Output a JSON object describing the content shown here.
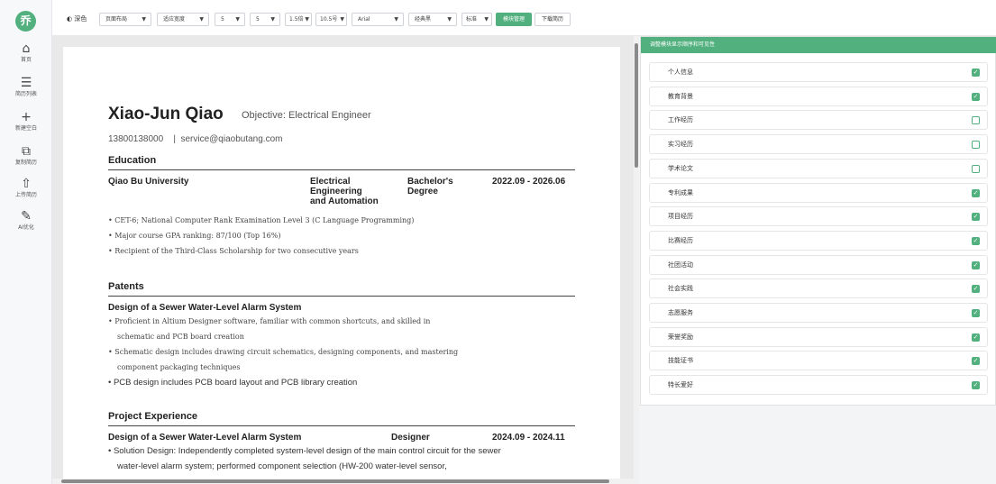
{
  "rail": {
    "logo": "乔",
    "items": [
      {
        "icon": "⌂",
        "label": "首页"
      },
      {
        "icon": "☰",
        "label": "简历列表"
      },
      {
        "icon": "+",
        "label": "新建空白"
      },
      {
        "icon": "⧉",
        "label": "复制简历"
      },
      {
        "icon": "⇧",
        "label": "上传简历"
      },
      {
        "icon": "✎",
        "label": "AI优化"
      }
    ]
  },
  "toolbar": {
    "theme_icon": "◐",
    "theme_label": "深色",
    "layout": "页面布局",
    "width": "适应宽度",
    "opt1": "5",
    "opt2": "5",
    "line_height": "1.5倍",
    "font_size": "10.5号",
    "font_family": "Arial",
    "template": "经典黑",
    "standard": "标准",
    "module_manage": "模块管理",
    "download": "下载简历",
    "arrow": "▼"
  },
  "resume": {
    "name": "Xiao-Jun Qiao",
    "objective": "Objective: Electrical Engineer",
    "phone": "13800138000",
    "separator": "|",
    "email": "service@qiaobutang.com",
    "education": {
      "title": "Education",
      "school": "Qiao Bu University",
      "major": [
        "Electrical",
        "Engineering",
        "and Automation"
      ],
      "degree": [
        "Bachelor's",
        "Degree"
      ],
      "dates": "2022.09 - 2026.06",
      "bullets": [
        "CET-6; National Computer Rank Examination Level 3 (C Language Programming)",
        "Major course GPA ranking: 87/100 (Top 16%)",
        "Recipient of the Third-Class Scholarship for two consecutive years"
      ]
    },
    "patents": {
      "title": "Patents",
      "item_title": "Design of a Sewer Water-Level Alarm System",
      "bullets": [
        "Proficient in Altium Designer software, familiar with common shortcuts, and skilled in",
        "schematic and PCB board creation",
        "Schematic design includes drawing circuit schematics, designing components, and mastering",
        "component packaging techniques",
        "PCB design includes PCB board layout and PCB library creation"
      ]
    },
    "projects": {
      "title": "Project Experience",
      "item_title": "Design of a Sewer Water-Level Alarm System",
      "role": "Designer",
      "dates": "2024.09 - 2024.11",
      "lines": [
        "Solution Design: Independently completed system-level design of the main control circuit for the sewer",
        "water-level alarm system; performed component selection (HW-200 water-level sensor,"
      ]
    },
    "bullet_char": "•"
  },
  "panel": {
    "title": "调整模块显示顺序和可见性",
    "modules": [
      {
        "label": "个人信息",
        "checked": true
      },
      {
        "label": "教育背景",
        "checked": true
      },
      {
        "label": "工作经历",
        "checked": false
      },
      {
        "label": "实习经历",
        "checked": false
      },
      {
        "label": "学术论文",
        "checked": false
      },
      {
        "label": "专利成果",
        "checked": true
      },
      {
        "label": "项目经历",
        "checked": true
      },
      {
        "label": "比赛经历",
        "checked": true
      },
      {
        "label": "社团活动",
        "checked": true
      },
      {
        "label": "社会实践",
        "checked": true
      },
      {
        "label": "志愿服务",
        "checked": true
      },
      {
        "label": "荣誉奖励",
        "checked": true
      },
      {
        "label": "技能证书",
        "checked": true
      },
      {
        "label": "特长爱好",
        "checked": true
      }
    ]
  },
  "colors": {
    "accent": "#52b07e"
  }
}
